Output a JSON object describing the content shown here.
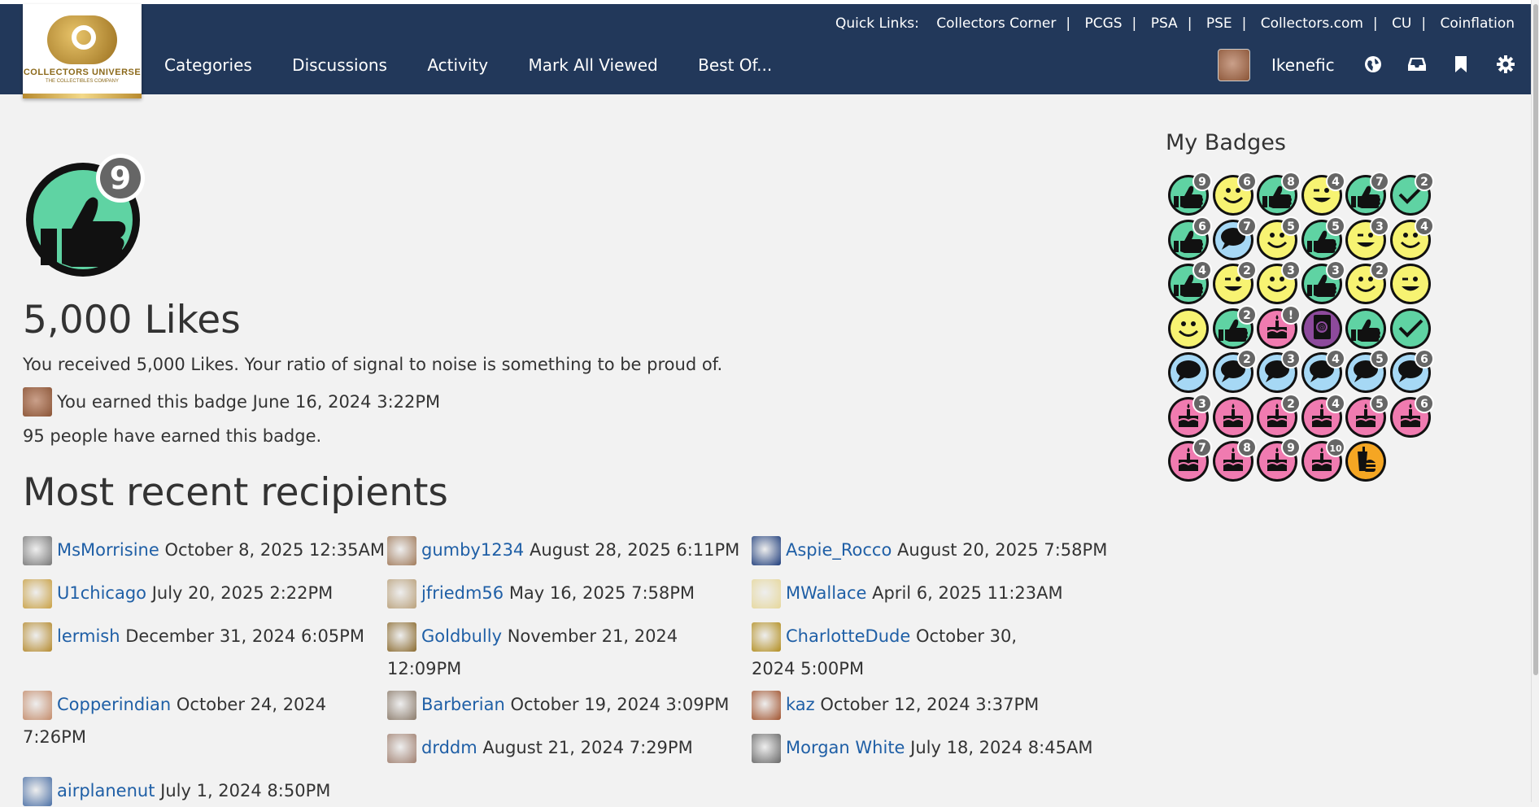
{
  "header": {
    "logo_text": "COLLECTORS UNIVERSE",
    "logo_sub": "THE COLLECTIBLES COMPANY",
    "quick_links_label": "Quick Links:",
    "quick_links": [
      "Collectors Corner",
      "PCGS",
      "PSA",
      "PSE",
      "Collectors.com",
      "CU",
      "Coinflation"
    ],
    "nav": [
      "Categories",
      "Discussions",
      "Activity",
      "Mark All Viewed",
      "Best Of..."
    ],
    "username": "Ikenefic",
    "icons": [
      "globe-icon",
      "inbox-icon",
      "bookmark-icon",
      "gear-icon"
    ]
  },
  "badge": {
    "level": "9",
    "title": "5,000 Likes",
    "description": "You received 5,000 Likes. Your ratio of signal to noise is something to be proud of.",
    "earned_text": "You earned this badge June 16, 2024 3:22PM",
    "people_text": "95 people have earned this badge."
  },
  "recipients_title": "Most recent recipients",
  "recipients": [
    {
      "name": "MsMorrisine",
      "date": "October 8, 2025 12:35AM",
      "color": "#777"
    },
    {
      "name": "gumby1234",
      "date": "August 28, 2025 6:11PM",
      "color": "#a07a5a"
    },
    {
      "name": "Aspie_Rocco",
      "date": "August 20, 2025 7:58PM",
      "color": "#1c3b7a"
    },
    {
      "name": "U1chicago",
      "date": "July 20, 2025 2:22PM",
      "color": "#c9a043"
    },
    {
      "name": "jfriedm56",
      "date": "May 16, 2025 7:58PM",
      "color": "#b9a07a"
    },
    {
      "name": "MWallace",
      "date": "April 6, 2025 11:23AM",
      "color": "#e6d79a"
    },
    {
      "name": "lermish",
      "date": "December 31, 2024 6:05PM",
      "color": "#b58a2d"
    },
    {
      "name": "Goldbully",
      "date": "November 21, 2024 12:09PM",
      "color": "#8a6a2e"
    },
    {
      "name": "CharlotteDude",
      "date": "October 30, 2024 5:00PM",
      "color": "#b28d1e"
    },
    {
      "name": "Copperindian",
      "date": "October 24, 2024 7:26PM",
      "color": "#c48b6a"
    },
    {
      "name": "Barberian",
      "date": "October 19, 2024 3:09PM",
      "color": "#8a7a6a"
    },
    {
      "name": "kaz",
      "date": "October 12, 2024 3:37PM",
      "color": "#a0522d"
    },
    {
      "name": "drddm",
      "date": "August 21, 2024 7:29PM",
      "color": "#a08070"
    },
    {
      "name": "Morgan White",
      "date": "July 18, 2024 8:45AM",
      "color": "#666"
    },
    {
      "name": "airplanenut",
      "date": "July 1, 2024 8:50PM",
      "color": "#4a6fa5"
    }
  ],
  "sidebar": {
    "title": "My Badges",
    "badges": [
      {
        "icon": "thumbs-up-icon",
        "num": "9"
      },
      {
        "icon": "smile-icon",
        "num": "6"
      },
      {
        "icon": "thumbs-up-icon",
        "num": "8"
      },
      {
        "icon": "wink-icon",
        "num": "4"
      },
      {
        "icon": "thumbs-up-icon",
        "num": "7"
      },
      {
        "icon": "check-icon",
        "num": "2"
      },
      {
        "icon": "thumbs-up-icon",
        "num": "6"
      },
      {
        "icon": "comment-icon",
        "num": "7"
      },
      {
        "icon": "smile-icon",
        "num": "5"
      },
      {
        "icon": "thumbs-up-icon",
        "num": "5"
      },
      {
        "icon": "wink-icon",
        "num": "3"
      },
      {
        "icon": "smile-icon",
        "num": "4"
      },
      {
        "icon": "thumbs-up-icon",
        "num": "4"
      },
      {
        "icon": "wink-icon",
        "num": "2"
      },
      {
        "icon": "smile-icon",
        "num": "3"
      },
      {
        "icon": "thumbs-up-icon",
        "num": "3"
      },
      {
        "icon": "smile-icon",
        "num": "2"
      },
      {
        "icon": "wink-icon",
        "num": ""
      },
      {
        "icon": "smile-icon",
        "num": ""
      },
      {
        "icon": "thumbs-up-icon",
        "num": "2"
      },
      {
        "icon": "cake-icon",
        "num": "!"
      },
      {
        "icon": "address-book-icon",
        "num": ""
      },
      {
        "icon": "thumbs-up-icon",
        "num": ""
      },
      {
        "icon": "check-icon",
        "num": ""
      },
      {
        "icon": "comment-icon",
        "num": ""
      },
      {
        "icon": "comment-icon",
        "num": "2"
      },
      {
        "icon": "comment-icon",
        "num": "3"
      },
      {
        "icon": "comment-icon",
        "num": "4"
      },
      {
        "icon": "comment-icon",
        "num": "5"
      },
      {
        "icon": "comment-icon",
        "num": "6"
      },
      {
        "icon": "cake-icon",
        "num": "3"
      },
      {
        "icon": "cake-icon",
        "num": ""
      },
      {
        "icon": "cake-icon",
        "num": "2"
      },
      {
        "icon": "cake-icon",
        "num": "4"
      },
      {
        "icon": "cake-icon",
        "num": "5"
      },
      {
        "icon": "cake-icon",
        "num": "6"
      },
      {
        "icon": "cake-icon",
        "num": "7"
      },
      {
        "icon": "cake-icon",
        "num": "8"
      },
      {
        "icon": "cake-icon",
        "num": "9"
      },
      {
        "icon": "cake-icon",
        "num": "10"
      },
      {
        "icon": "food-icon",
        "num": ""
      }
    ]
  },
  "colors": {
    "nav_bg": "#22385a",
    "link": "#1f5fa6",
    "green": "#5fd3a3",
    "yellow": "#f7f372",
    "blue": "#a6d8f5",
    "pink": "#f07bb0",
    "purple": "#8d4a9c",
    "orange": "#f5a623"
  }
}
